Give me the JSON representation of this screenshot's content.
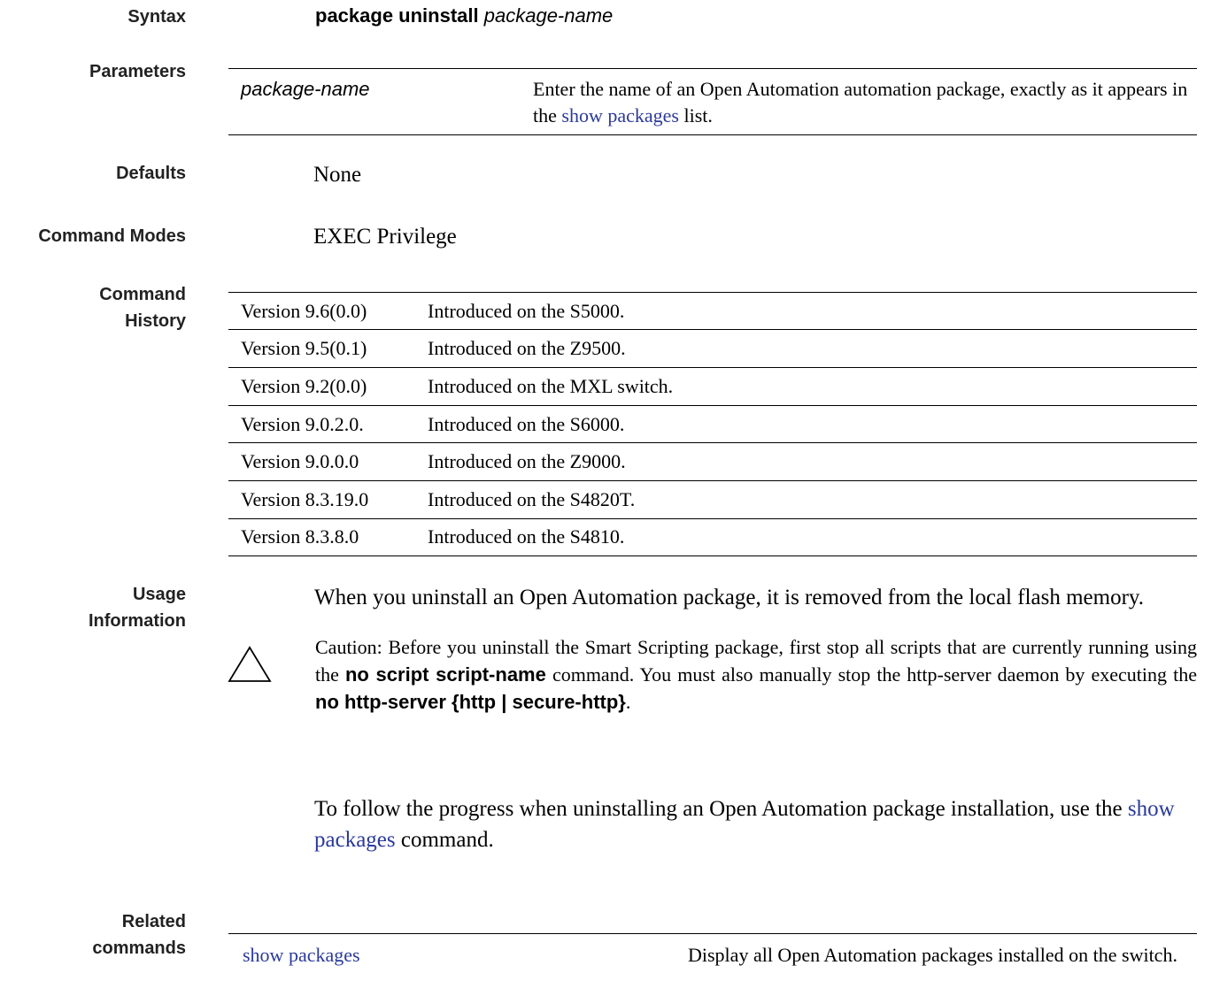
{
  "syntax": {
    "label": "Syntax",
    "command": "package uninstall",
    "argument": "package-name"
  },
  "parameters": {
    "label": "Parameters",
    "rows": [
      {
        "name": "package-name",
        "desc_before": "Enter the name of an Open Automation automation package, exactly as it appears in the ",
        "desc_link": "show packages",
        "desc_after": " list."
      }
    ]
  },
  "defaults": {
    "label": "Defaults",
    "value": "None"
  },
  "command_modes": {
    "label": "Command Modes",
    "value": "EXEC Privilege"
  },
  "command_history": {
    "label_line1": "Command",
    "label_line2": "History",
    "rows": [
      {
        "version": "Version 9.6(0.0)",
        "desc": "Introduced on the S5000."
      },
      {
        "version": "Version 9.5(0.1)",
        "desc": "Introduced on the Z9500."
      },
      {
        "version": "Version 9.2(0.0)",
        "desc": "Introduced on the MXL switch."
      },
      {
        "version": "Version 9.0.2.0.",
        "desc": "Introduced on the S6000."
      },
      {
        "version": "Version 9.0.0.0",
        "desc": "Introduced on the Z9000."
      },
      {
        "version": "Version 8.3.19.0",
        "desc": "Introduced on the S4820T."
      },
      {
        "version": "Version 8.3.8.0",
        "desc": "Introduced on the S4810."
      }
    ]
  },
  "usage": {
    "label_line1": "Usage",
    "label_line2": "Information",
    "paragraph1": "When you uninstall an Open Automation package, it is removed from the local flash memory.",
    "caution": {
      "icon": "caution-triangle-icon",
      "text1": "Caution: Before you uninstall the Smart Scripting package, first stop all scripts that are currently running using the ",
      "cmd1": "no script script-name",
      "text2": " command. You must also manually stop the http-server daemon by executing the ",
      "cmd2": "no http-server {http | secure-http}",
      "text3": "."
    },
    "paragraph2_before": "To follow the progress when uninstalling an Open Automation package installation, use the ",
    "paragraph2_link": "show packages",
    "paragraph2_after": " command."
  },
  "related": {
    "label_line1": "Related",
    "label_line2": "commands",
    "rows": [
      {
        "command": "show packages",
        "desc": "Display all Open Automation packages installed on the switch."
      }
    ]
  },
  "colors": {
    "link": "#2b3a9a",
    "label": "#222222"
  }
}
